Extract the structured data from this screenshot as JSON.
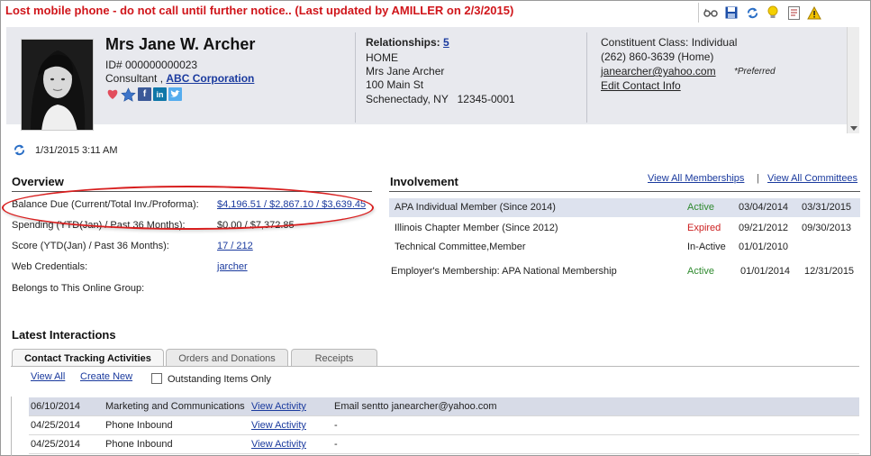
{
  "alert": "Lost mobile phone - do not call until further notice.. (Last updated by AMILLER on 2/3/2015)",
  "toolbar": {
    "icons": [
      "glasses-icon",
      "save-icon",
      "refresh-icon",
      "lightbulb-icon",
      "report-icon",
      "warning-icon"
    ]
  },
  "constituent": {
    "name": "Mrs Jane W. Archer",
    "id": "ID# 000000000023",
    "role": "Consultant ,",
    "company": "ABC Corporation"
  },
  "relationships": {
    "label": "Relationships:",
    "count": "5",
    "address_type": "HOME",
    "addressee": "Mrs Jane Archer",
    "street": "100 Main St",
    "city_state_zip": "Schenectady, NY   12345-0001"
  },
  "contact": {
    "class": "Constituent Class: Individual",
    "phone": "(262) 860-3639 (Home)",
    "email": "janearcher@yahoo.com",
    "preferred": "*Preferred",
    "edit": "Edit Contact Info"
  },
  "refresh": {
    "timestamp": "1/31/2015 3:11 AM"
  },
  "overview": {
    "title": "Overview",
    "rows": [
      {
        "label": "Balance Due (Current/Total Inv./Proforma):",
        "value": "$4,196.51 / $2,867.10 / $3,639.45"
      },
      {
        "label": "Spending (YTD(Jan) / Past 36 Months):",
        "value": "$0.00 / $7,372.85"
      },
      {
        "label": "Score (YTD(Jan) / Past 36 Months):",
        "value": "17 / 212"
      },
      {
        "label": "Web Credentials:",
        "value": "jarcher"
      },
      {
        "label": "Belongs to This Online Group:",
        "value": ""
      }
    ]
  },
  "involvement": {
    "title": "Involvement",
    "view_memberships": "View All Memberships",
    "separator": "|",
    "view_committees": "View All Committees",
    "rows": [
      {
        "name": "APA Individual Member (Since 2014)",
        "status": "Active",
        "start": "03/04/2014",
        "end": "03/31/2015"
      },
      {
        "name": "Illinois Chapter Member (Since 2012)",
        "status": "Expired",
        "start": "09/21/2012",
        "end": "09/30/2013"
      },
      {
        "name": "Technical Committee,Member",
        "status": "In-Active",
        "start": "01/01/2010",
        "end": ""
      },
      {
        "name": "Employer's Membership: APA National Membership",
        "status": "Active",
        "start": "01/01/2014",
        "end": "12/31/2015"
      }
    ]
  },
  "interactions": {
    "title": "Latest Interactions",
    "tabs": [
      "Contact Tracking Activities",
      "Orders and Donations",
      "Receipts"
    ],
    "view_all": "View All",
    "create_new": "Create New",
    "outstanding": "Outstanding Items Only",
    "rows": [
      {
        "date": "06/10/2014",
        "type": "Marketing and Communications",
        "link": "View Activity",
        "desc": "Email sentto janearcher@yahoo.com"
      },
      {
        "date": "04/25/2014",
        "type": "Phone Inbound",
        "link": "View Activity",
        "desc": "-"
      },
      {
        "date": "04/25/2014",
        "type": "Phone Inbound",
        "link": "View Activity",
        "desc": "-"
      }
    ]
  }
}
